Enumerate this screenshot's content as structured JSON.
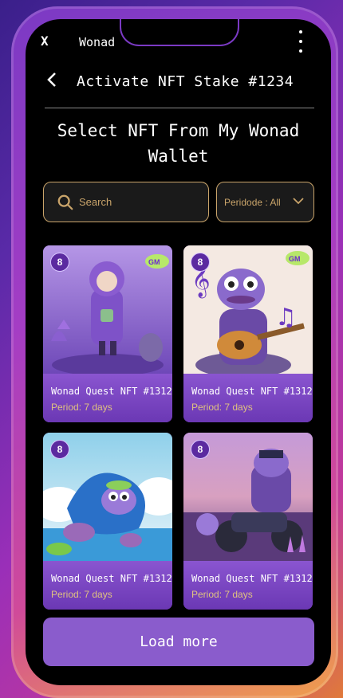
{
  "topbar": {
    "close_label": "X",
    "title": "Wonad"
  },
  "nav": {
    "back_label": "<",
    "title": "Activate NFT Stake #1234"
  },
  "heading": "Select NFT From My Wonad Wallet",
  "search": {
    "placeholder": "Search"
  },
  "period_filter": {
    "label": "Peridode : All"
  },
  "cards": [
    {
      "badge": "8",
      "name": "Wonad Quest NFT #1312",
      "period": "Period: 7 days",
      "art": "purple-hooded-girl"
    },
    {
      "badge": "8",
      "name": "Wonad Quest NFT #1312",
      "period": "Period: 7 days",
      "art": "frog-guitar"
    },
    {
      "badge": "8",
      "name": "Wonad Quest NFT #1312",
      "period": "Period: 7 days",
      "art": "whale-frog"
    },
    {
      "badge": "8",
      "name": "Wonad Quest NFT #1312",
      "period": "Period: 7 days",
      "art": "frog-motorcycle"
    }
  ],
  "load_more_label": "Load more",
  "colors": {
    "accent_gold": "#c9a46a",
    "card_purple": "#7a45c2",
    "button_purple": "#8a5ccc"
  }
}
